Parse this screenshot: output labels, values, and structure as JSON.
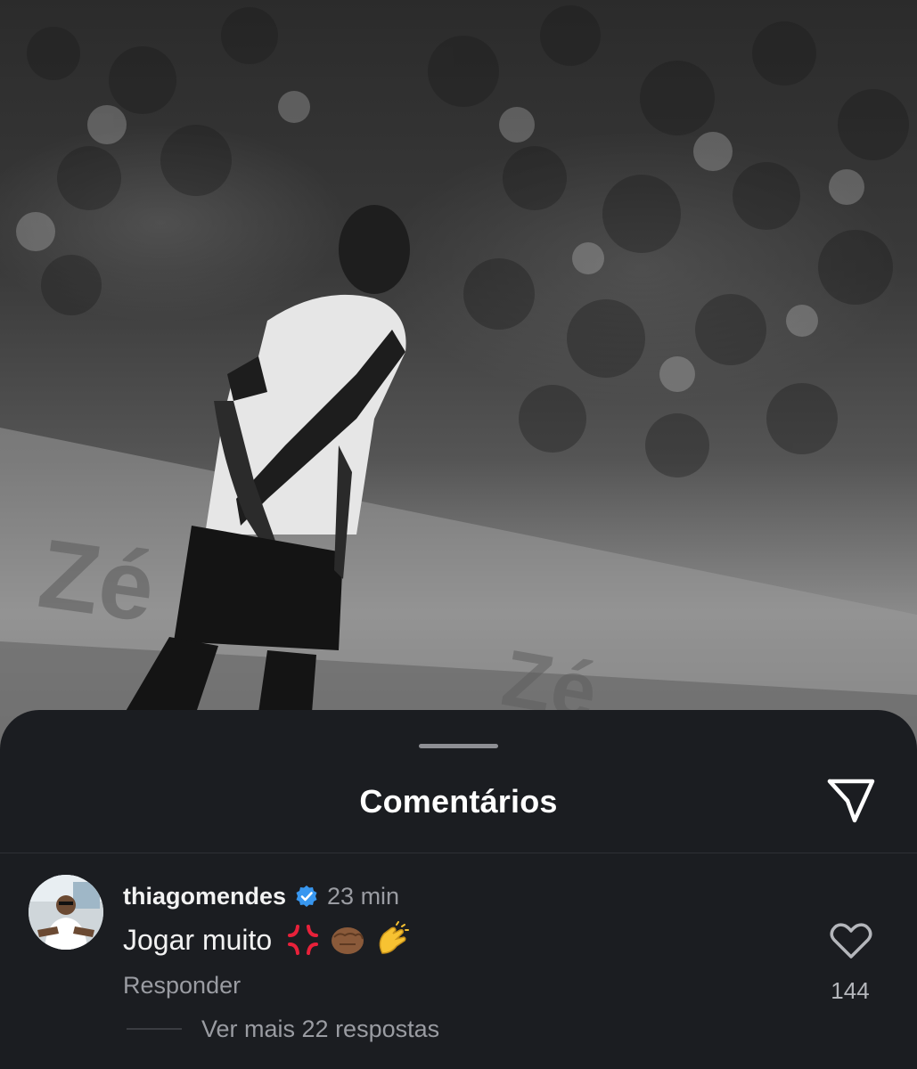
{
  "background": {
    "photo_icon": "football-player-photo",
    "style": "grayscale"
  },
  "sheet": {
    "title": "Comentários",
    "share_icon": "send-icon"
  },
  "comment": {
    "username": "thiagomendes",
    "verified": true,
    "time": "23 min",
    "text": "Jogar muito",
    "emojis": [
      "anger-symbol",
      "oncoming-fist",
      "clapping-hands"
    ],
    "reply_label": "Responder",
    "likes": "144",
    "view_more_replies": "Ver mais 22 respostas"
  },
  "colors": {
    "sheet_bg": "#1b1d21",
    "verified_blue": "#3897f0",
    "secondary_text": "#9a9ca2"
  }
}
